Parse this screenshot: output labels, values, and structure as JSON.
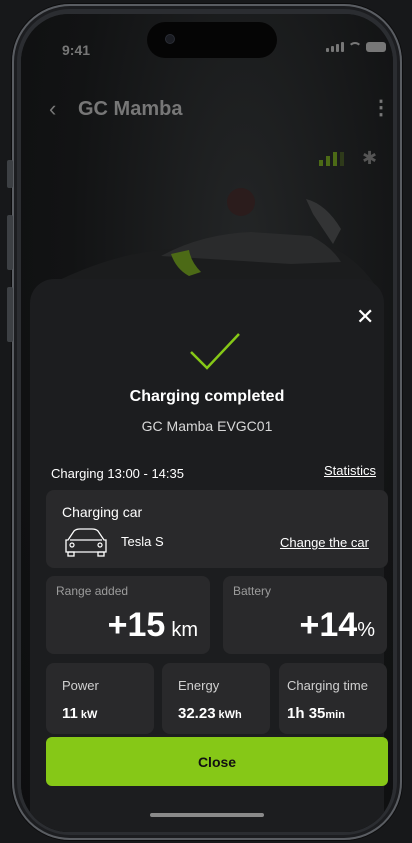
{
  "status_bar": {
    "time": "9:41"
  },
  "header": {
    "title": "GC Mamba"
  },
  "dialog": {
    "title": "Charging completed",
    "charger_name": "GC Mamba EVGC01",
    "period": "Charging 13:00 - 14:35",
    "statistics_link": "Statistics",
    "car": {
      "label": "Charging car",
      "name": "Tesla S",
      "change_link": "Change the car"
    },
    "range": {
      "label": "Range added",
      "value": "+15",
      "unit": "km"
    },
    "battery": {
      "label": "Battery",
      "value": "+14",
      "unit": "%"
    },
    "power": {
      "label": "Power",
      "value": "11",
      "unit": "kW"
    },
    "energy": {
      "label": "Energy",
      "value": "32.23",
      "unit": "kWh"
    },
    "time": {
      "label": "Charging time",
      "hours": "1h",
      "minutes": "35",
      "min_unit": "min"
    },
    "close_button": "Close"
  },
  "colors": {
    "accent": "#86c817",
    "sheet_bg": "#1c1d1f",
    "card_bg": "#29292b"
  }
}
